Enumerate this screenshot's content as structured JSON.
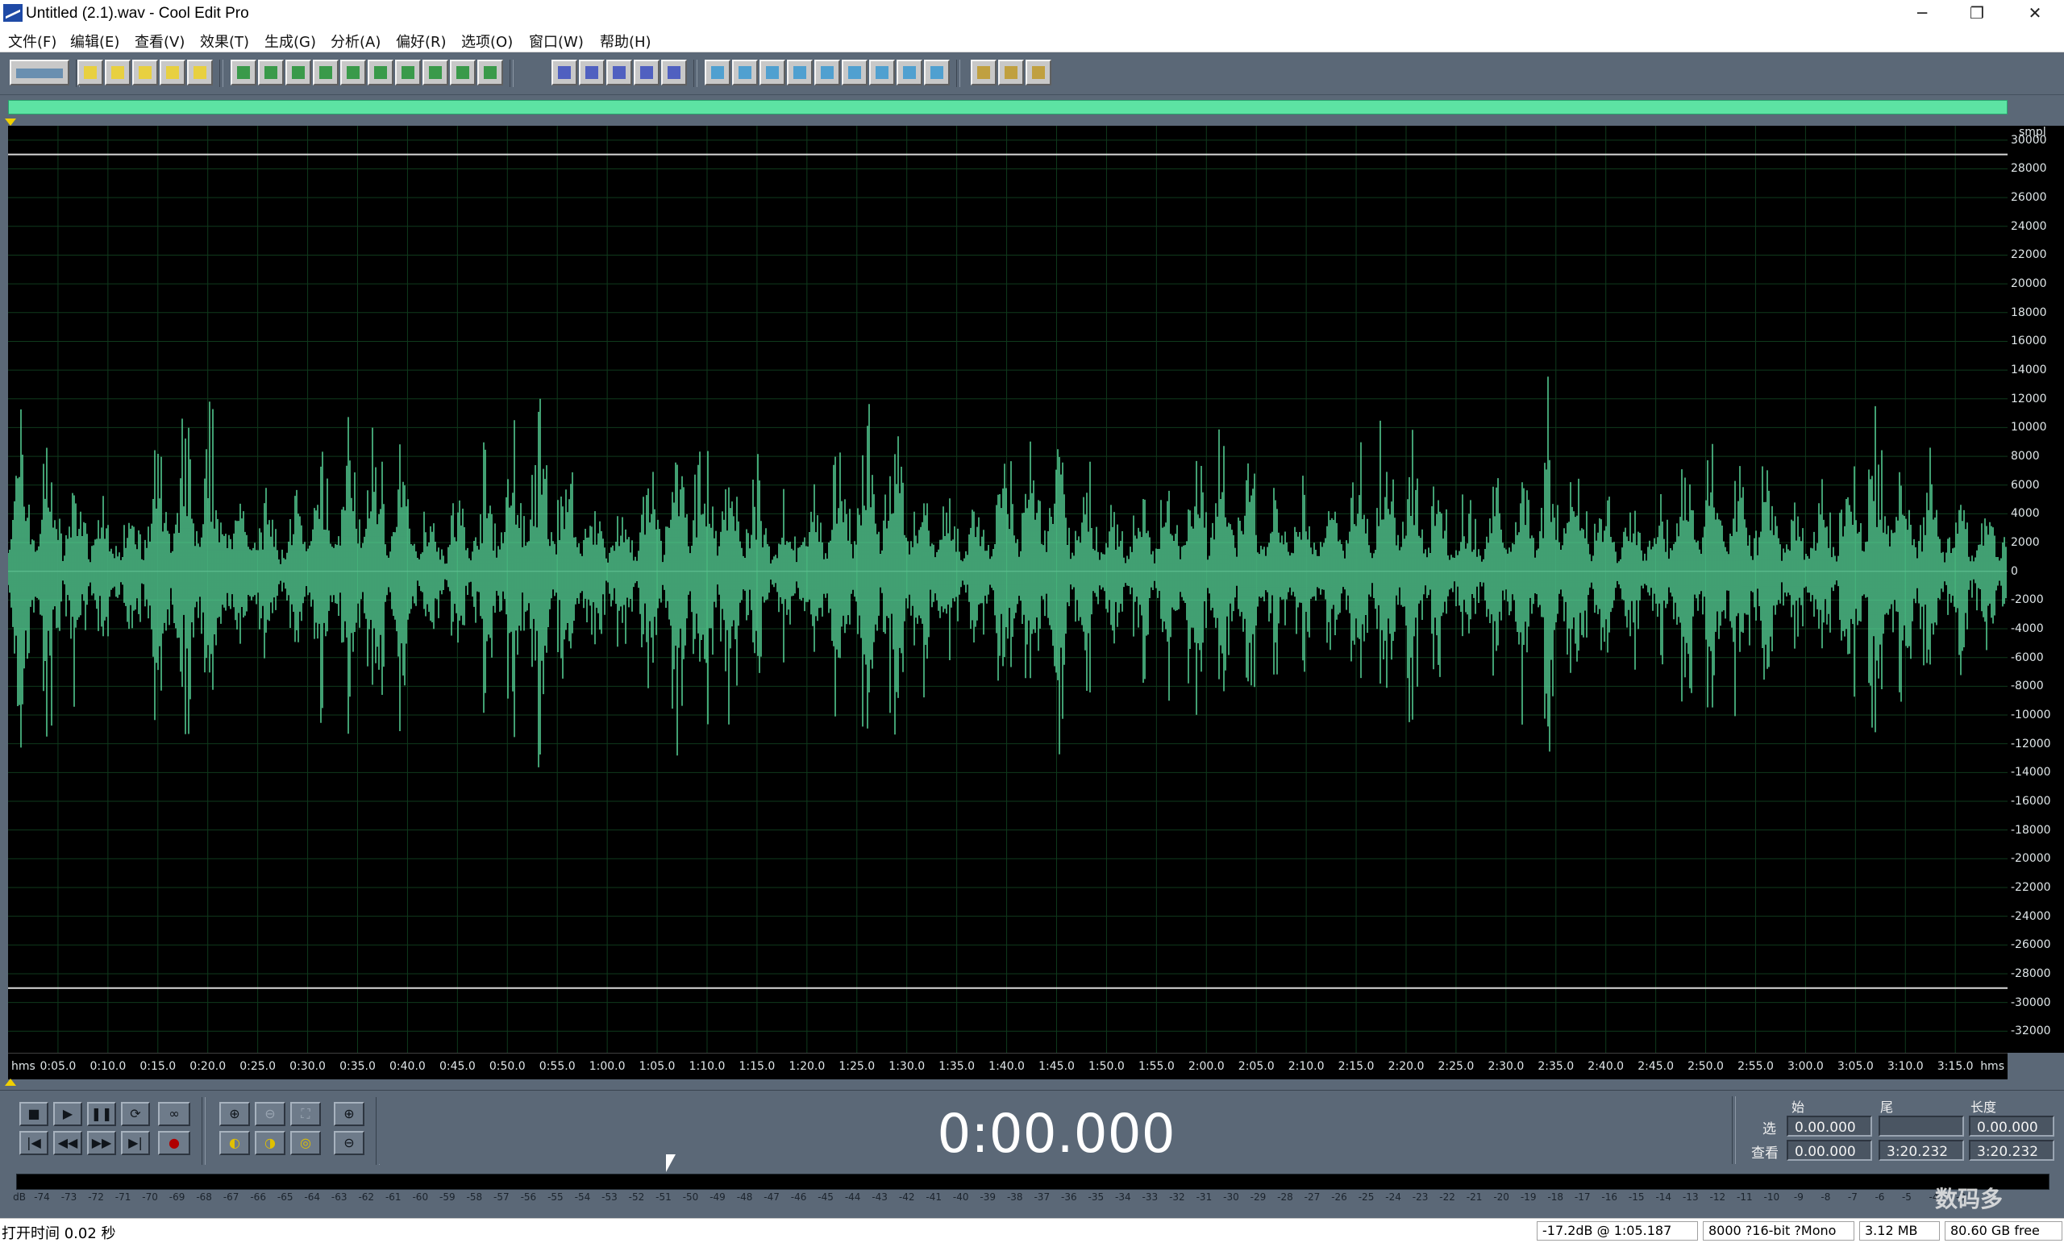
{
  "window": {
    "title": "Untitled (2.1).wav - Cool Edit Pro",
    "minimize": "─",
    "restore": "❐",
    "close": "✕"
  },
  "menu": [
    "文件(F)",
    "编辑(E)",
    "查看(V)",
    "效果(T)",
    "生成(G)",
    "分析(A)",
    "偏好(R)",
    "选项(O)",
    "窗口(W)",
    "帮助(H)"
  ],
  "toolbar": {
    "icons": [
      "multitrack-toggle-icon",
      "new-file-icon",
      "open-file-icon",
      "save-icon",
      "save-all-icon",
      "close-file-icon",
      "undo-icon",
      "redo-icon",
      "repeat-icon",
      "copy-icon",
      "copy-to-new-icon",
      "cut-icon",
      "paste-icon",
      "paste-new-icon",
      "mix-paste-icon",
      "crop-icon",
      "show-waveform-icon",
      "spectral-view-icon",
      "snap-icon",
      "time-format-icon",
      "cue-list-icon",
      "play-list-icon",
      "properties-icon",
      "info-icon",
      "play-icon",
      "zoom-fit-icon",
      "time-display-icon",
      "grid-icon",
      "color-icon",
      "bar-icon",
      "settings-icon",
      "script-icon",
      "help-icon"
    ]
  },
  "waveform": {
    "color": "#5de3a3",
    "background": "#000000",
    "grid_color": "#0f3a1c",
    "y_unit": "smpl",
    "y_ticks": [
      "30000",
      "28000",
      "26000",
      "24000",
      "22000",
      "20000",
      "18000",
      "16000",
      "14000",
      "12000",
      "10000",
      "8000",
      "6000",
      "4000",
      "2000",
      "0",
      "-2000",
      "-4000",
      "-6000",
      "-8000",
      "-10000",
      "-12000",
      "-14000",
      "-16000",
      "-18000",
      "-20000",
      "-22000",
      "-24000",
      "-26000",
      "-28000",
      "-30000",
      "-32000"
    ],
    "x_unit": "hms",
    "x_ticks": [
      "0:05.0",
      "0:10.0",
      "0:15.0",
      "0:20.0",
      "0:25.0",
      "0:30.0",
      "0:35.0",
      "0:40.0",
      "0:45.0",
      "0:50.0",
      "0:55.0",
      "1:00.0",
      "1:05.0",
      "1:10.0",
      "1:15.0",
      "1:20.0",
      "1:25.0",
      "1:30.0",
      "1:35.0",
      "1:40.0",
      "1:45.0",
      "1:50.0",
      "1:55.0",
      "2:00.0",
      "2:05.0",
      "2:10.0",
      "2:15.0",
      "2:20.0",
      "2:25.0",
      "2:30.0",
      "2:35.0",
      "2:40.0",
      "2:45.0",
      "2:50.0",
      "2:55.0",
      "3:00.0",
      "3:05.0",
      "3:10.0",
      "3:15.0"
    ]
  },
  "transport": {
    "buttons": [
      "■",
      "▶",
      "❚❚",
      "⟳",
      "∞",
      "|◀",
      "◀◀",
      "▶▶",
      "▶|",
      "●"
    ],
    "time": "0:00.000"
  },
  "selection": {
    "headers": [
      "始",
      "尾",
      "长度"
    ],
    "row_select_label": "选",
    "row_view_label": "查看",
    "select_begin": "0.00.000",
    "select_end": "",
    "select_length": "0.00.000",
    "view_begin": "0.00.000",
    "view_end": "3:20.232",
    "view_length": "3:20.232"
  },
  "meter": {
    "unit": "dB",
    "ticks": [
      "-74",
      "-73",
      "-72",
      "-71",
      "-70",
      "-69",
      "-68",
      "-67",
      "-66",
      "-65",
      "-64",
      "-63",
      "-62",
      "-61",
      "-60",
      "-59",
      "-58",
      "-57",
      "-56",
      "-55",
      "-54",
      "-53",
      "-52",
      "-51",
      "-50",
      "-49",
      "-48",
      "-47",
      "-46",
      "-45",
      "-44",
      "-43",
      "-42",
      "-41",
      "-40",
      "-39",
      "-38",
      "-37",
      "-36",
      "-35",
      "-34",
      "-33",
      "-32",
      "-31",
      "-30",
      "-29",
      "-28",
      "-27",
      "-26",
      "-25",
      "-24",
      "-23",
      "-22",
      "-21",
      "-20",
      "-19",
      "-18",
      "-17",
      "-16",
      "-15",
      "-14",
      "-13",
      "-12",
      "-11",
      "-10",
      "-9",
      "-8",
      "-7",
      "-6",
      "-5",
      "-4",
      "-3"
    ]
  },
  "status": {
    "left": "打开时间  0.02 秒",
    "level": "-17.2dB @  1:05.187",
    "format": "8000 ?16-bit ?Mono",
    "size": "3.12 MB",
    "free": "80.60 GB free"
  },
  "watermark": "数码多"
}
